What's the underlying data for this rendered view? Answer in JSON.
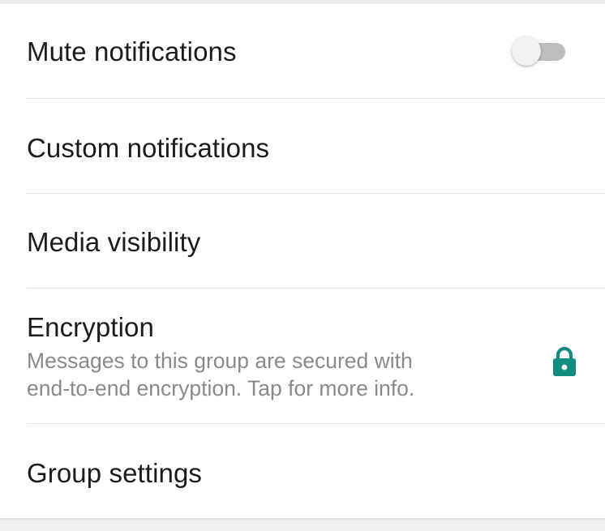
{
  "settings": {
    "mute": {
      "label": "Mute notifications",
      "enabled": false
    },
    "custom": {
      "label": "Custom notifications"
    },
    "media": {
      "label": "Media visibility"
    },
    "encryption": {
      "label": "Encryption",
      "description_line1": "Messages to this group are secured with",
      "description_line2": "end-to-end encryption. Tap for more info.",
      "icon": "lock-icon",
      "icon_color": "#128c7e"
    },
    "group": {
      "label": "Group settings"
    }
  }
}
